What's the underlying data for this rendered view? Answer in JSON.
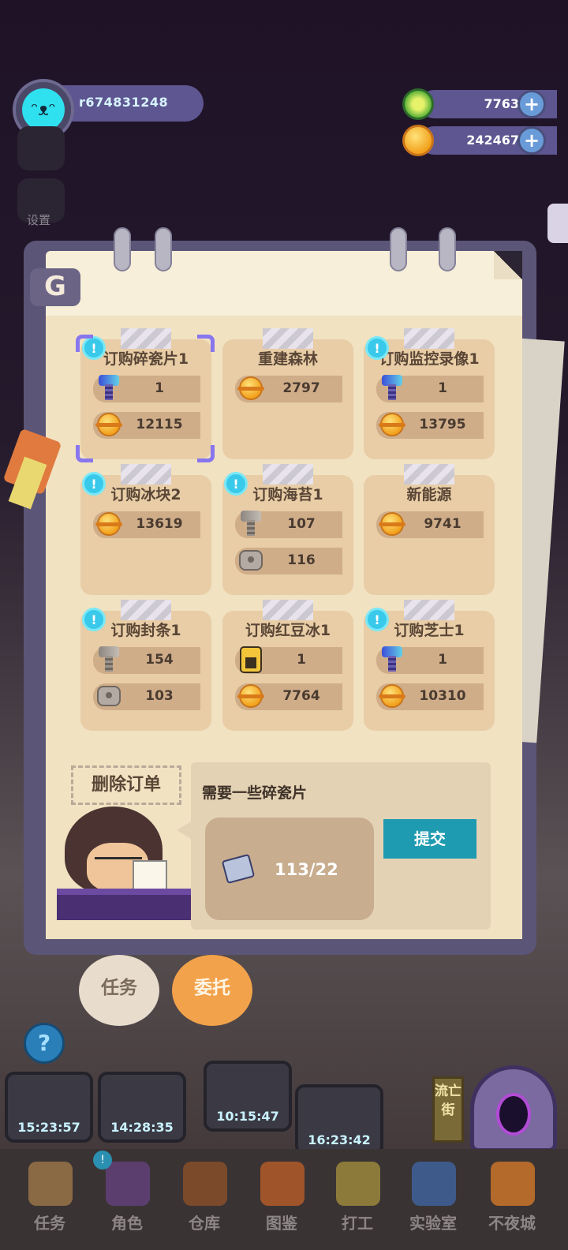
{
  "player": {
    "username": "r674831248"
  },
  "currency": {
    "gems": "7763",
    "coins": "242467",
    "plus_label": "+"
  },
  "sidebar": {
    "settings_label": "设置"
  },
  "panel": {
    "back_label": "G"
  },
  "orders": [
    {
      "title": "订购碎瓷片1",
      "alert": true,
      "selected": true,
      "rows": [
        {
          "icon": "bolt-blue-icon",
          "value": "1"
        },
        {
          "icon": "coin-icon",
          "value": "12115"
        }
      ]
    },
    {
      "title": "重建森林",
      "alert": false,
      "selected": false,
      "rows": [
        {
          "icon": "coin-icon",
          "value": "2797"
        }
      ]
    },
    {
      "title": "订购监控录像1",
      "alert": true,
      "selected": false,
      "rows": [
        {
          "icon": "bolt-blue-icon",
          "value": "1"
        },
        {
          "icon": "coin-icon",
          "value": "13795"
        }
      ]
    },
    {
      "title": "订购冰块2",
      "alert": true,
      "selected": false,
      "rows": [
        {
          "icon": "coin-icon",
          "value": "13619"
        }
      ]
    },
    {
      "title": "订购海苔1",
      "alert": true,
      "selected": false,
      "rows": [
        {
          "icon": "bolt-gray-icon",
          "value": "107"
        },
        {
          "icon": "nut-icon",
          "value": "116"
        }
      ]
    },
    {
      "title": "新能源",
      "alert": false,
      "selected": false,
      "rows": [
        {
          "icon": "coin-icon",
          "value": "9741"
        }
      ]
    },
    {
      "title": "订购封条1",
      "alert": true,
      "selected": false,
      "rows": [
        {
          "icon": "bolt-gray-icon",
          "value": "154"
        },
        {
          "icon": "nut-icon",
          "value": "103"
        }
      ]
    },
    {
      "title": "订购红豆冰1",
      "alert": false,
      "selected": false,
      "rows": [
        {
          "icon": "battery-icon",
          "value": "1"
        },
        {
          "icon": "coin-icon",
          "value": "7764"
        }
      ]
    },
    {
      "title": "订购芝士1",
      "alert": true,
      "selected": false,
      "rows": [
        {
          "icon": "bolt-blue-icon",
          "value": "1"
        },
        {
          "icon": "coin-icon",
          "value": "10310"
        }
      ]
    }
  ],
  "alert_label": "!",
  "detail": {
    "delete_label": "删除订单",
    "need_text": "需要一些碎瓷片",
    "item_progress": "113/22",
    "submit_label": "提交"
  },
  "panel_tabs": [
    {
      "label": "任务",
      "active": false
    },
    {
      "label": "委托",
      "active": true
    }
  ],
  "help_label": "?",
  "machines": [
    "15:23:57",
    "14:28:35",
    "10:15:47",
    "16:23:42"
  ],
  "street_sign": "流亡街",
  "nav": [
    {
      "label": "任务",
      "icon": "scroll-icon"
    },
    {
      "label": "角色",
      "icon": "character-icon"
    },
    {
      "label": "仓库",
      "icon": "chest-icon"
    },
    {
      "label": "图鉴",
      "icon": "book-icon"
    },
    {
      "label": "打工",
      "icon": "work-icon"
    },
    {
      "label": "实验室",
      "icon": "lab-icon"
    },
    {
      "label": "不夜城",
      "icon": "city-icon"
    }
  ],
  "colors": {
    "accent_blue": "#1e9ab1",
    "card": "#e8cda6",
    "pill": "#5d5690",
    "selection": "#8876ee",
    "active_tab": "#f2a24a",
    "inactive_tab": "#e8dccd"
  }
}
